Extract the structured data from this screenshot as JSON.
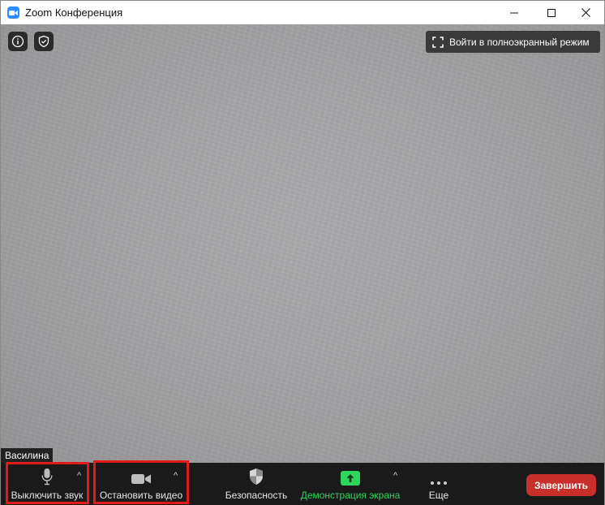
{
  "window": {
    "title": "Zoom Конференция",
    "controls": {
      "minimize": "minimize-icon",
      "maximize": "maximize-icon",
      "close": "close-icon"
    }
  },
  "video": {
    "fullscreen_label": "Войти в полноэкранный режим",
    "participant_name": "Василина",
    "top_icons": [
      "info-icon",
      "shield-check-icon"
    ]
  },
  "toolbar": {
    "mute_label": "Выключить звук",
    "stop_video_label": "Остановить видео",
    "security_label": "Безопасность",
    "share_label": "Демонстрация экрана",
    "more_label": "Еще",
    "end_label": "Завершить"
  },
  "colors": {
    "accent_blue": "#2d8cff",
    "share_green": "#2dd55b",
    "end_red": "#c9302c",
    "toolbar_bg": "#1a1a1a",
    "highlight_red": "#e31a1a"
  }
}
